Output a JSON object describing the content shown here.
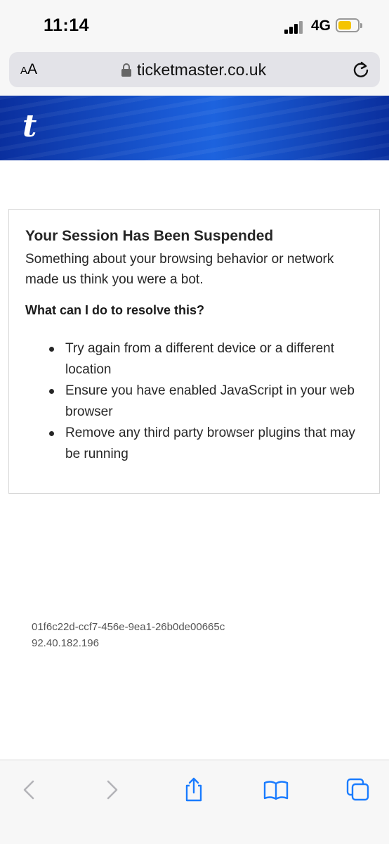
{
  "status_bar": {
    "time": "11:14",
    "network": "4G",
    "battery_level": 0.55,
    "battery_color": "#f5c400",
    "signal_icon": "cellular-signal-icon"
  },
  "browser": {
    "text_size_label": "AA",
    "url": "ticketmaster.co.uk",
    "lock_icon": "lock-icon",
    "reload_icon": "reload-icon"
  },
  "banner": {
    "logo": "t",
    "color": "#0a2f9e"
  },
  "notice": {
    "title": "Your Session Has Been Suspended",
    "message": "Something about your browsing behavior or network made us think you were a bot.",
    "subheading": "What can I do to resolve this?",
    "items": [
      "Try again from a different device or a different location",
      "Ensure you have enabled JavaScript in your web browser",
      "Remove any third party browser plugins that may be running"
    ]
  },
  "footer": {
    "session_id": "01f6c22d-ccf7-456e-9ea1-26b0de00665c",
    "ip": "92.40.182.196"
  },
  "toolbar": {
    "icons": [
      "back-icon",
      "forward-icon",
      "share-icon",
      "bookmarks-icon",
      "tabs-icon"
    ],
    "accent": "#1a7cff",
    "disabled": "#b4b4b8"
  }
}
